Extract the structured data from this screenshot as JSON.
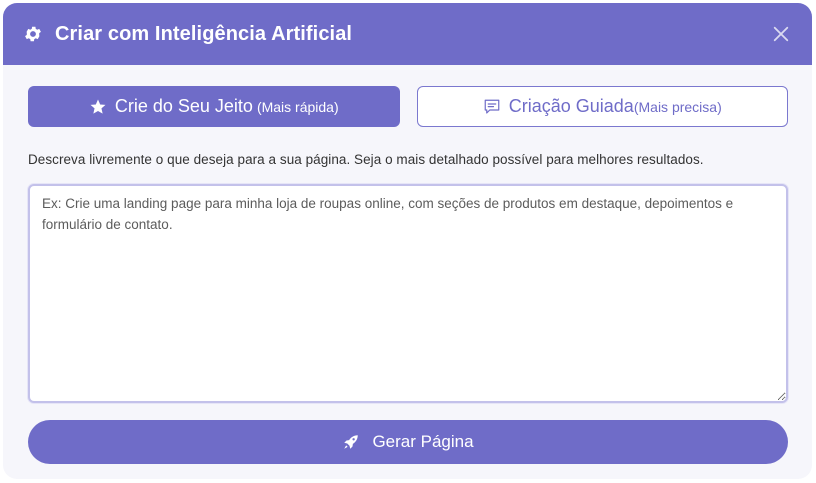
{
  "header": {
    "title": "Criar com Inteligência Artificial",
    "icon": "gear-icon",
    "close_icon": "close-icon"
  },
  "tabs": [
    {
      "label": "Crie do Seu Jeito",
      "sublabel": "(Mais rápida)",
      "icon": "star-icon",
      "active": true
    },
    {
      "label": "Criação Guiada",
      "sublabel": "(Mais precisa)",
      "icon": "comment-icon",
      "active": false
    }
  ],
  "description": "Descreva livremente o que deseja para a sua página. Seja o mais detalhado possível para melhores resultados.",
  "prompt_input": {
    "value": "",
    "placeholder": "Ex: Crie uma landing page para minha loja de roupas online, com seções de produtos em destaque, depoimentos e formulário de contato."
  },
  "generate_button": {
    "label": "Gerar Página",
    "icon": "rocket-icon"
  },
  "colors": {
    "accent": "#6f6cc8",
    "background": "#f6f6fb",
    "border": "#c3c1ea"
  }
}
